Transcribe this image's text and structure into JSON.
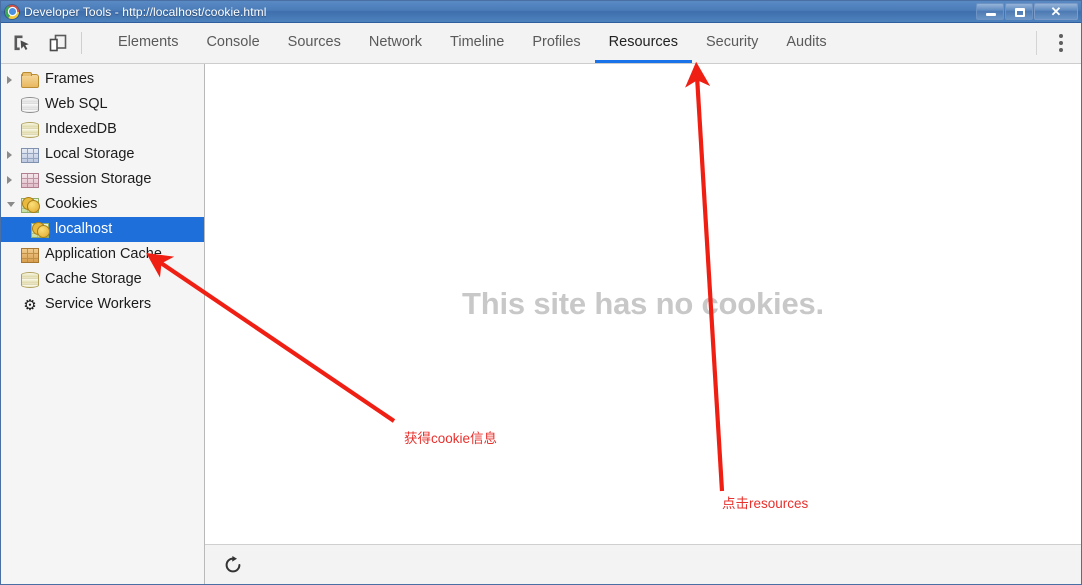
{
  "window": {
    "title": "Developer Tools - http://localhost/cookie.html",
    "logo_icon": "chrome-logo-icon",
    "controls": [
      {
        "name": "minimize",
        "label": "minimize-icon"
      },
      {
        "name": "maximize",
        "label": "maximize-icon"
      },
      {
        "name": "close",
        "label": "✕"
      }
    ]
  },
  "toolbar": {
    "inspect_icon": "inspect-element-icon",
    "device_icon": "toggle-device-toolbar-icon",
    "menu_icon": "more-options-kebab-icon"
  },
  "tabs": [
    {
      "label": "Elements",
      "active": false
    },
    {
      "label": "Console",
      "active": false
    },
    {
      "label": "Sources",
      "active": false
    },
    {
      "label": "Network",
      "active": false
    },
    {
      "label": "Timeline",
      "active": false
    },
    {
      "label": "Profiles",
      "active": false
    },
    {
      "label": "Resources",
      "active": true
    },
    {
      "label": "Security",
      "active": false
    },
    {
      "label": "Audits",
      "active": false
    }
  ],
  "sidebar": {
    "items": [
      {
        "label": "Frames",
        "icon": "folder-icon",
        "twisty": "collapsed",
        "indent": false,
        "selected": false
      },
      {
        "label": "Web SQL",
        "icon": "database-icon",
        "twisty": "none",
        "indent": false,
        "selected": false
      },
      {
        "label": "IndexedDB",
        "icon": "database-gold-icon",
        "twisty": "none",
        "indent": false,
        "selected": false
      },
      {
        "label": "Local Storage",
        "icon": "table-blue-icon",
        "twisty": "collapsed",
        "indent": false,
        "selected": false
      },
      {
        "label": "Session Storage",
        "icon": "table-pink-icon",
        "twisty": "collapsed",
        "indent": false,
        "selected": false
      },
      {
        "label": "Cookies",
        "icon": "cookie-icon",
        "twisty": "expanded",
        "indent": false,
        "selected": false
      },
      {
        "label": "localhost",
        "icon": "cookie-icon",
        "twisty": "none",
        "indent": true,
        "selected": true
      },
      {
        "label": "Application Cache",
        "icon": "table-orange-icon",
        "twisty": "none",
        "indent": false,
        "selected": false
      },
      {
        "label": "Cache Storage",
        "icon": "database-gold-icon",
        "twisty": "none",
        "indent": false,
        "selected": false
      },
      {
        "label": "Service Workers",
        "icon": "gear-icon",
        "twisty": "none",
        "indent": false,
        "selected": false
      }
    ]
  },
  "content": {
    "empty_message": "This site has no cookies.",
    "refresh_icon": "refresh-icon"
  },
  "annotations": {
    "accent_color": "#e8302c",
    "cookie_note": "获得cookie信息",
    "resources_note": "点击resources"
  }
}
